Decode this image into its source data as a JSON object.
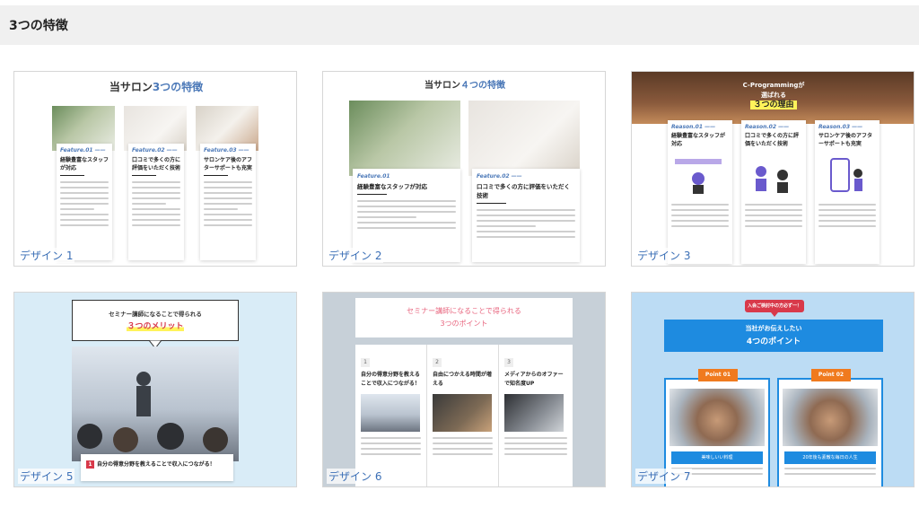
{
  "header": {
    "title": "3つの特徴"
  },
  "cards": [
    {
      "caption": "デザイン 1",
      "title_a": "当サロン",
      "title_b": "3つの特徴",
      "columns": [
        {
          "feature": "Feature.01 ——",
          "heading_1": "経験豊富なスタッフ",
          "heading_2": "が対応"
        },
        {
          "feature": "Feature.02 ——",
          "heading_1": "口コミで多くの方に",
          "heading_2": "評価をいただく技術"
        },
        {
          "feature": "Feature.03 ——",
          "heading_1": "サロンケア後のアフ",
          "heading_2": "ターサポートも充実"
        }
      ]
    },
    {
      "caption": "デザイン 2",
      "title_a": "当サロン",
      "title_b": "４つの特徴",
      "columns": [
        {
          "feature": "Feature.01",
          "heading_1": "経験豊富なスタッフが対応"
        },
        {
          "feature": "Feature.02 ——",
          "heading_1": "口コミで多くの方に評価をいただく技術"
        }
      ]
    },
    {
      "caption": "デザイン 3",
      "title_line1": "C-Programmingが",
      "title_line2": "選ばれる",
      "title_highlight": "３つの理由",
      "columns": [
        {
          "feature": "Reason.01 ——",
          "heading_1": "経験豊富なスタッフが",
          "heading_2": "対応"
        },
        {
          "feature": "Reason.02 ——",
          "heading_1": "口コミで多くの方に評",
          "heading_2": "価をいただく技術"
        },
        {
          "feature": "Reason.03 ——",
          "heading_1": "サロンケア後のアフタ",
          "heading_2": "ーサポートも充実"
        }
      ]
    },
    {
      "caption": "デザイン 5",
      "title_line1": "セミナー講師になることで得られる",
      "title_highlight": "３つのメリット",
      "item_number": "1",
      "item_text": "自分の得意分野を教えることで収入につながる！"
    },
    {
      "caption": "デザイン 6",
      "title_line1": "セミナー講師になることで得られる",
      "title_line2": "3つのポイント",
      "columns": [
        {
          "number": "1",
          "heading_1": "自分の得意分野を教える",
          "heading_2": "ことで収入につながる！"
        },
        {
          "number": "2",
          "heading_1": "自由につかえる時間が増",
          "heading_2": "える"
        },
        {
          "number": "3",
          "heading_1": "メディアからのオファー",
          "heading_2": "で知名度UP"
        }
      ]
    },
    {
      "caption": "デザイン 7",
      "badge": "入会ご検討中の方必ず一！",
      "banner_line1": "当社がお伝えしたい",
      "banner_line2": "4つのポイント",
      "points": [
        {
          "label": "Point 01",
          "button": "美味しいい料理"
        },
        {
          "label": "Point 02",
          "button": "20年後も素敵な毎日の人生"
        }
      ]
    }
  ]
}
